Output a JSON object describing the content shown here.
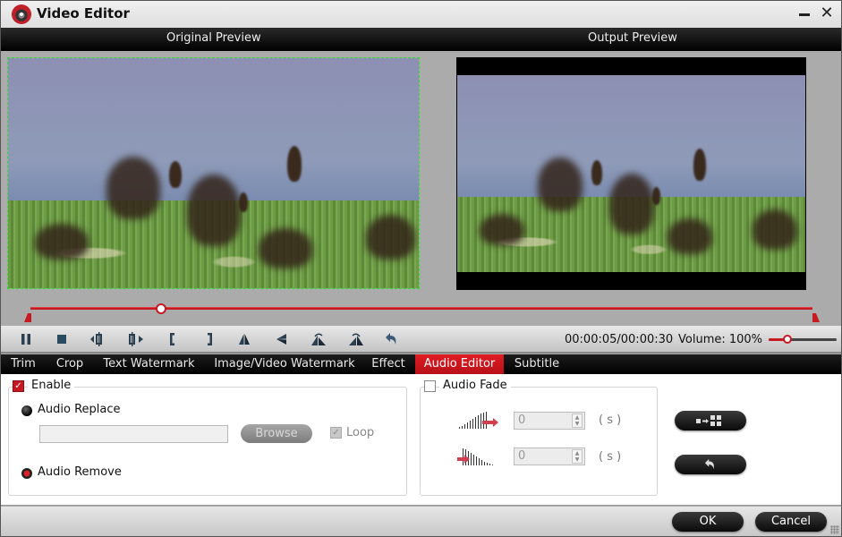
{
  "window": {
    "title": "Video Editor",
    "minimize_icon": "minimize-icon",
    "close_icon": "close-icon"
  },
  "preview": {
    "original_label": "Original Preview",
    "output_label": "Output Preview"
  },
  "timeline": {
    "position_fraction": 0.1667,
    "trim_start_fraction": 0.0,
    "trim_end_fraction": 1.0
  },
  "controls": {
    "buttons": [
      {
        "name": "pause",
        "icon": "pause-icon"
      },
      {
        "name": "stop",
        "icon": "stop-icon"
      },
      {
        "name": "previous-frame",
        "icon": "previous-frame-icon"
      },
      {
        "name": "next-frame",
        "icon": "next-frame-icon"
      },
      {
        "name": "set-start",
        "icon": "left-bracket-icon"
      },
      {
        "name": "set-end",
        "icon": "right-bracket-icon"
      },
      {
        "name": "flip-horizontal",
        "icon": "flip-horizontal-icon"
      },
      {
        "name": "flip-vertical",
        "icon": "flip-vertical-icon"
      },
      {
        "name": "rotate-left",
        "icon": "rotate-left-icon"
      },
      {
        "name": "rotate-right",
        "icon": "rotate-right-icon"
      },
      {
        "name": "reset",
        "icon": "undo-icon"
      }
    ],
    "time": "00:00:05/00:00:30",
    "volume_label": "Volume: 100%",
    "volume_fraction": 0.27
  },
  "tabs": [
    {
      "label": "Trim",
      "active": false
    },
    {
      "label": "Crop",
      "active": false
    },
    {
      "label": "Text Watermark",
      "active": false
    },
    {
      "label": "Image/Video Watermark",
      "active": false
    },
    {
      "label": "Effect",
      "active": false
    },
    {
      "label": "Audio Editor",
      "active": true
    },
    {
      "label": "Subtitle",
      "active": false
    }
  ],
  "audio_editor": {
    "enable_label": "Enable",
    "enable_checked": true,
    "audio_replace_label": "Audio Replace",
    "audio_replace_selected": false,
    "file_path_value": "",
    "browse_label": "Browse",
    "loop_label": "Loop",
    "loop_checked": true,
    "audio_remove_label": "Audio Remove",
    "audio_remove_selected": true,
    "audio_fade_label": "Audio Fade",
    "audio_fade_checked": false,
    "fade_in_value": "0",
    "fade_out_value": "0",
    "unit_label": "( s )",
    "apply_to_all_icon": "apply-to-all-icon",
    "reset_icon": "undo-icon"
  },
  "footer": {
    "ok_label": "OK",
    "cancel_label": "Cancel"
  }
}
